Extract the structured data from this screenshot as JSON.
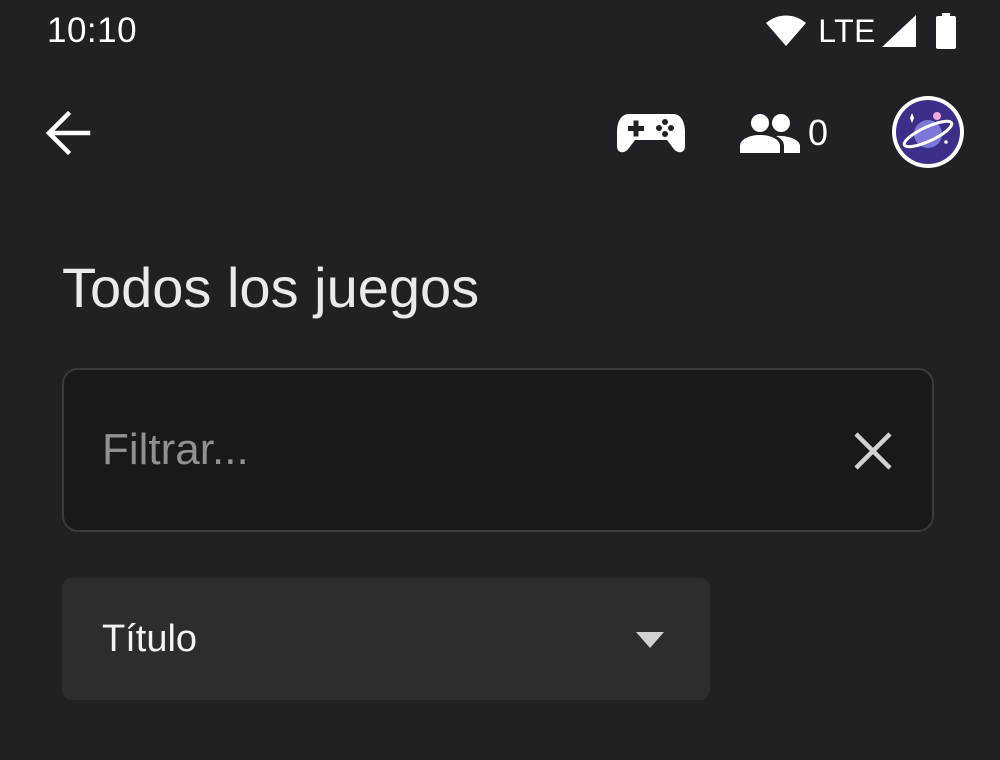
{
  "status_bar": {
    "time": "10:10",
    "network_label": "LTE"
  },
  "app_bar": {
    "back_icon": "arrow-back-icon",
    "controller_icon": "gamepad-icon",
    "friends_icon": "people-icon",
    "friends_count": "0",
    "avatar_icon": "planet-avatar"
  },
  "page": {
    "title": "Todos los juegos"
  },
  "filter": {
    "value": "",
    "placeholder": "Filtrar...",
    "clear_icon": "close-icon"
  },
  "sort": {
    "selected": "Título",
    "arrow_icon": "dropdown-arrow-icon"
  },
  "colors": {
    "background": "#202124",
    "field_background": "#18191b",
    "select_background": "#2c2d30",
    "text": "#e8eaed",
    "placeholder": "#8f9194",
    "avatar_bg": "#3b2f8a"
  }
}
